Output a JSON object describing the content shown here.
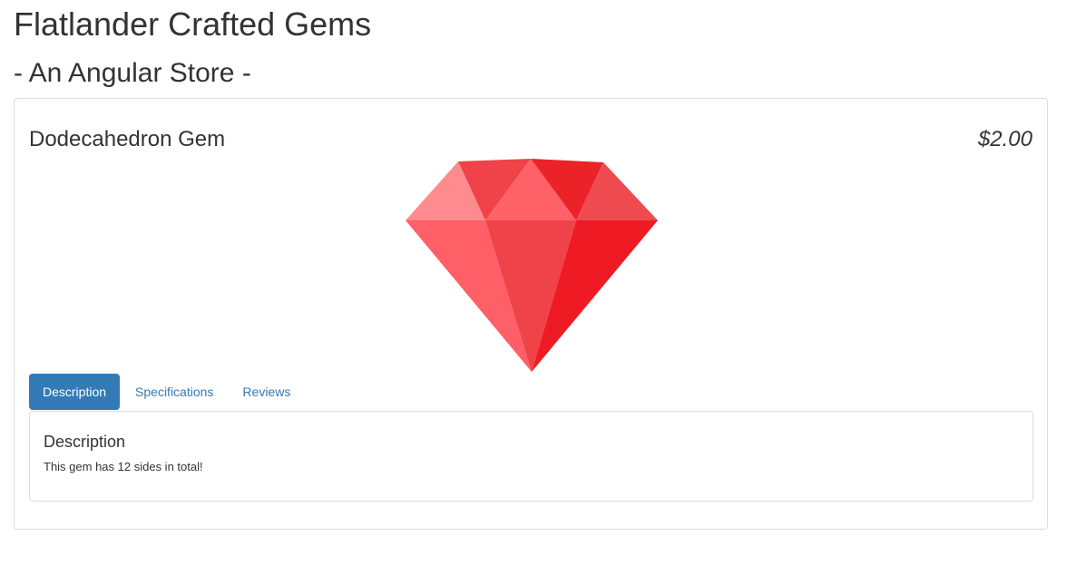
{
  "header": {
    "title": "Flatlander Crafted Gems",
    "subtitle": "- An Angular Store -"
  },
  "product": {
    "name": "Dodecahedron Gem",
    "price": "$2.00",
    "image_icon": "red-gem-icon",
    "tabs": [
      {
        "label": "Description",
        "active": true
      },
      {
        "label": "Specifications",
        "active": false
      },
      {
        "label": "Reviews",
        "active": false
      }
    ],
    "active_tab_panel": {
      "title": "Description",
      "text": "This gem has 12 sides in total!"
    }
  },
  "colors": {
    "brand_blue": "#337ab7",
    "gem_red_light": "#ff8b8f",
    "gem_red_mid": "#ff5f66",
    "gem_red_dark": "#ef1b24",
    "border": "#dddddd"
  }
}
